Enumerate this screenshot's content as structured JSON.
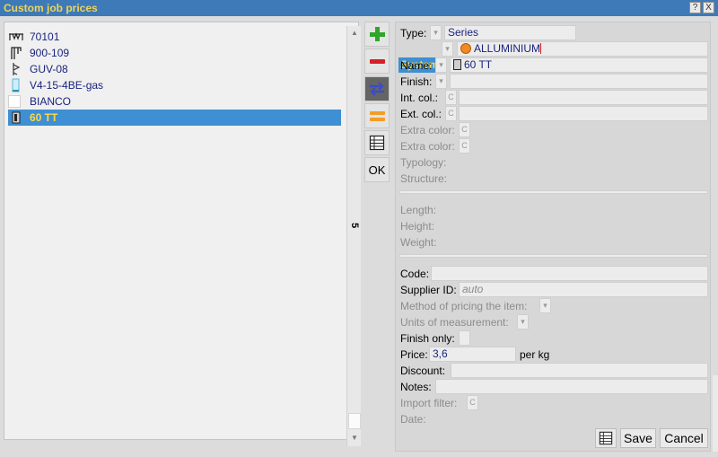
{
  "window": {
    "title": "Custom job prices",
    "help_btn": "?",
    "close_btn": "X"
  },
  "list": {
    "items": [
      {
        "label": "70101",
        "icon": "rail-profile-icon",
        "selected": false
      },
      {
        "label": "900-109",
        "icon": "bracket-profile-icon",
        "selected": false
      },
      {
        "label": "GUV-08",
        "icon": "gasket-profile-icon",
        "selected": false
      },
      {
        "label": "V4-15-4BE-gas",
        "icon": "glass-pane-icon",
        "selected": false
      },
      {
        "label": "BIANCO",
        "icon": "color-swatch-icon",
        "selected": false
      },
      {
        "label": "60 TT",
        "icon": "profile-section-icon",
        "selected": true
      }
    ],
    "scroll_label": "5"
  },
  "toolbar": {
    "ok_label": "OK"
  },
  "detail": {
    "type_label": "Type:",
    "type_value": "Series",
    "system_label": "System:",
    "system_value": "ALLUMINIUM",
    "name_label": "Name:",
    "name_value": "60 TT",
    "finish_label": "Finish:",
    "int_col_label": "Int. col.:",
    "ext_col_label": "Ext. col.:",
    "extra_color1_label": "Extra color:",
    "extra_color2_label": "Extra color:",
    "typology_label": "Typology:",
    "structure_label": "Structure:",
    "length_label": "Length:",
    "height_label": "Height:",
    "weight_label": "Weight:",
    "code_label": "Code:",
    "supplier_label": "Supplier ID:",
    "supplier_value": "auto",
    "method_label": "Method of pricing the item:",
    "units_label": "Units of measurement:",
    "finish_only_label": "Finish only:",
    "price_label": "Price:",
    "price_value": "3,6",
    "price_unit": "per kg",
    "discount_label": "Discount:",
    "notes_label": "Notes:",
    "import_filter_label": "Import filter:",
    "date_label": "Date:",
    "mini_c": "C",
    "save_label": "Save",
    "cancel_label": "Cancel"
  },
  "colors": {
    "titlebar": "#3d7ab7",
    "title_text": "#f0d35c",
    "selection": "#3e8fd3",
    "selection_text": "#ffd84a",
    "value_text": "#1a237e"
  }
}
